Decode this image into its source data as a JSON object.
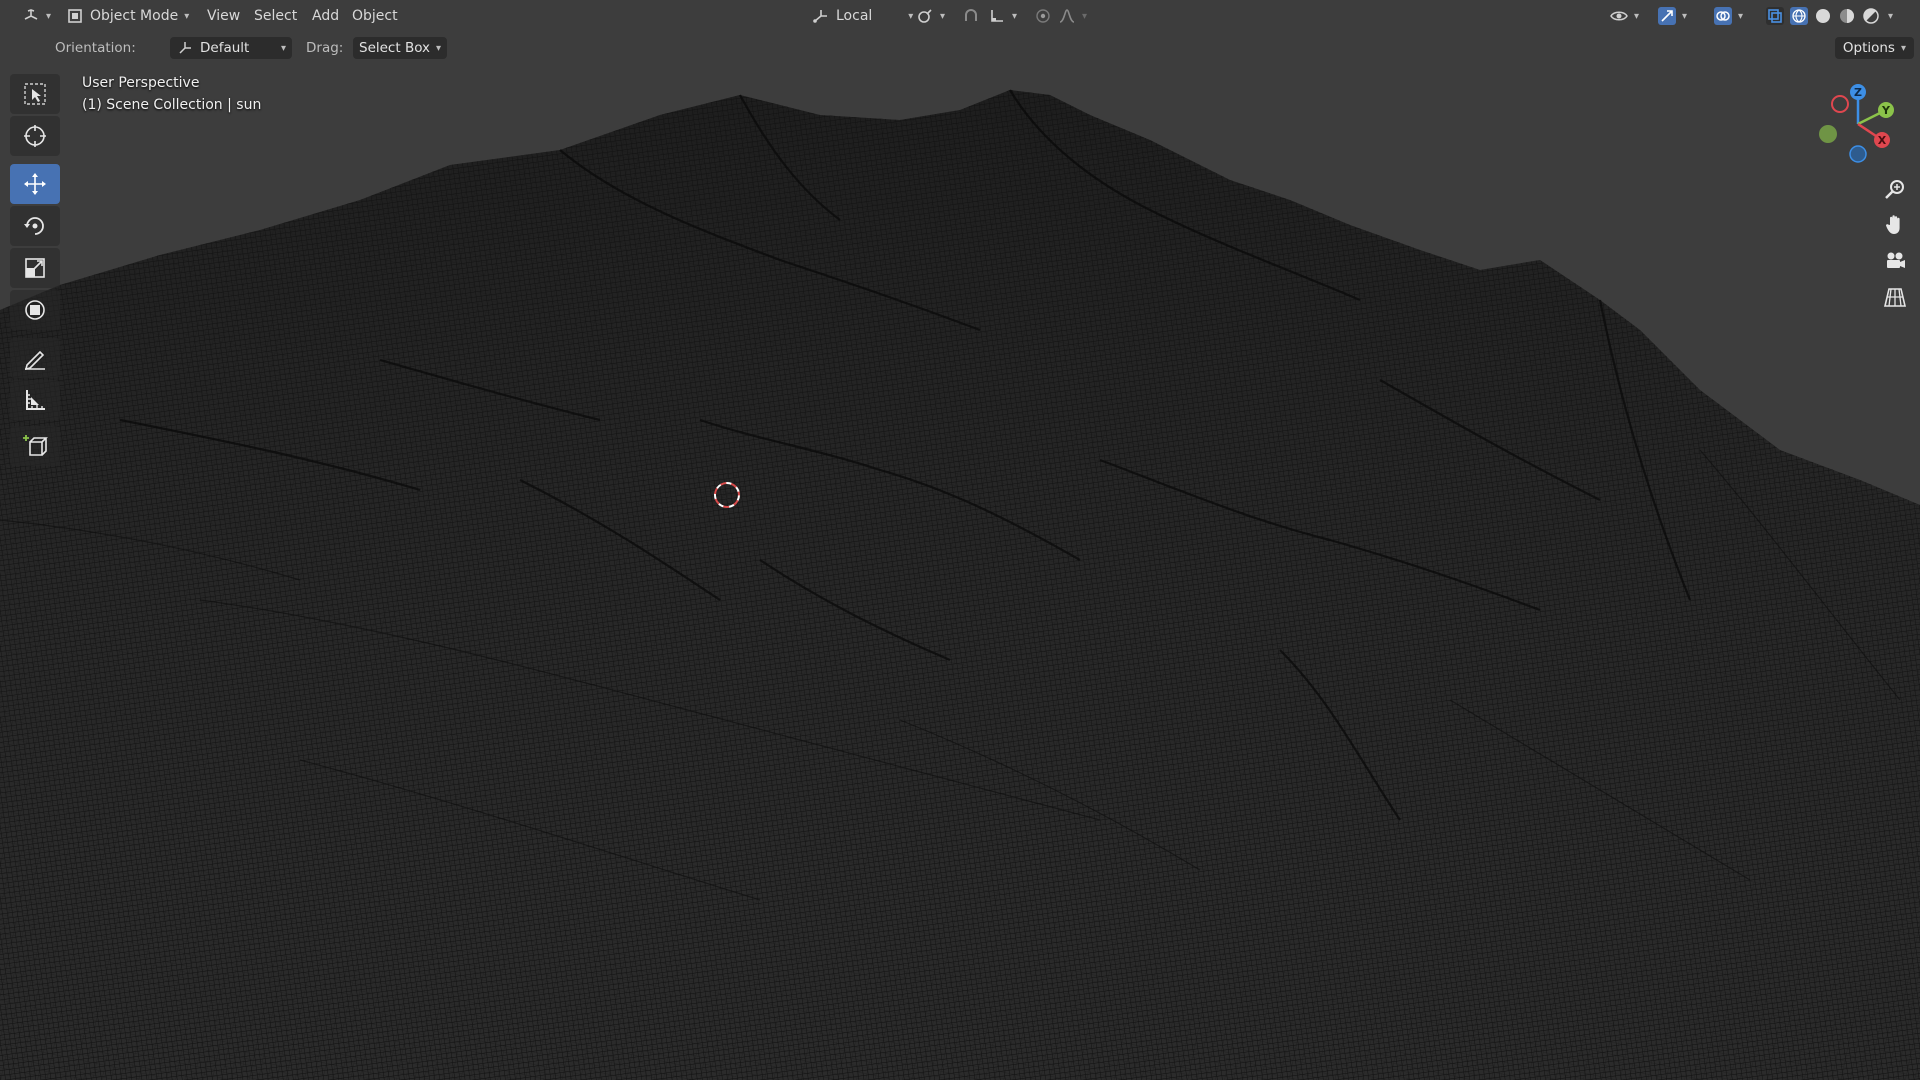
{
  "header": {
    "editor_type_icon": "3d-viewport-icon",
    "mode": "Object Mode",
    "menus": [
      "View",
      "Select",
      "Add",
      "Object"
    ],
    "transform_orientation": "Local",
    "icons": {
      "snap": "snap-icon",
      "proportional": "proportional-editing-icon",
      "visibility": "eye-icon",
      "gizmo": "gizmo-icon",
      "overlay": "overlay-icon",
      "xray": "xray-icon",
      "shading": [
        "wireframe-shading-icon",
        "solid-shading-icon",
        "material-shading-icon",
        "rendered-shading-icon"
      ]
    }
  },
  "tool_settings": {
    "orientation_label": "Orientation:",
    "orientation_value": "Default",
    "drag_label": "Drag:",
    "drag_value": "Select Box",
    "options_label": "Options"
  },
  "tools": [
    {
      "name": "select-box-tool",
      "active": false
    },
    {
      "name": "cursor-tool",
      "active": false
    },
    {
      "name": "move-tool",
      "active": true
    },
    {
      "name": "rotate-tool",
      "active": false
    },
    {
      "name": "scale-tool",
      "active": false
    },
    {
      "name": "transform-tool",
      "active": false
    },
    {
      "name": "annotate-tool",
      "active": false
    },
    {
      "name": "measure-tool",
      "active": false
    },
    {
      "name": "add-cube-tool",
      "active": false
    }
  ],
  "viewport": {
    "view_name": "User Perspective",
    "collection_info": "(1) Scene Collection | sun",
    "shading": "wireframe",
    "background_color": "#3d3d3d",
    "wire_color": "#0a0a0a"
  },
  "navigation": {
    "axes": [
      "Z",
      "Y",
      "X"
    ],
    "axis_colors": {
      "x": "#e0474f",
      "y": "#8bc34a",
      "z": "#3d8fe6"
    },
    "buttons": [
      "zoom-icon",
      "pan-hand-icon",
      "camera-icon",
      "perspective-grid-icon"
    ]
  }
}
